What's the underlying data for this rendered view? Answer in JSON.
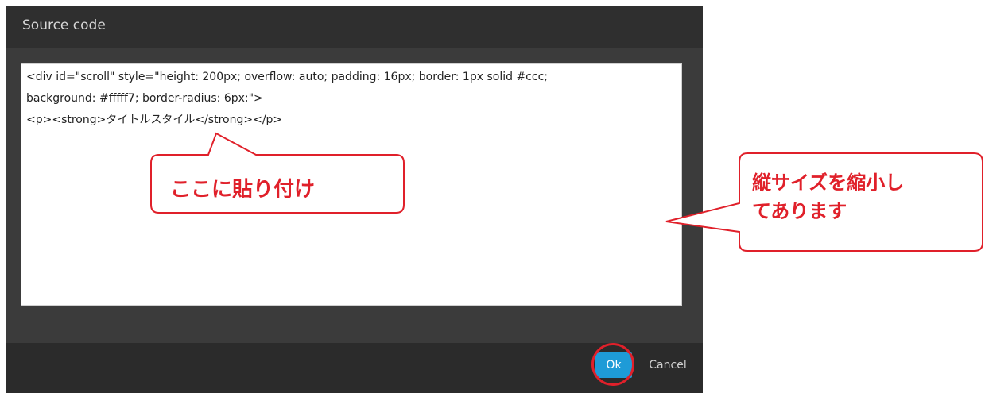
{
  "dialog": {
    "title": "Source code",
    "code_lines": [
      "<div id=\"scroll\" style=\"height: 200px; overflow: auto; padding: 16px; border: 1px solid #ccc;",
      "background: #fffff7; border-radius: 6px;\">",
      "<p><strong>タイトルスタイル</strong></p>"
    ],
    "ok_label": "Ok",
    "cancel_label": "Cancel"
  },
  "annotations": {
    "paste_here": "ここに貼り付け",
    "resize_note_line1": "縦サイズを縮小し",
    "resize_note_line2": "てあります"
  },
  "colors": {
    "accent_button": "#1e9bd7",
    "annotation_red": "#e0202a",
    "dialog_bg": "#3a3a3a"
  }
}
